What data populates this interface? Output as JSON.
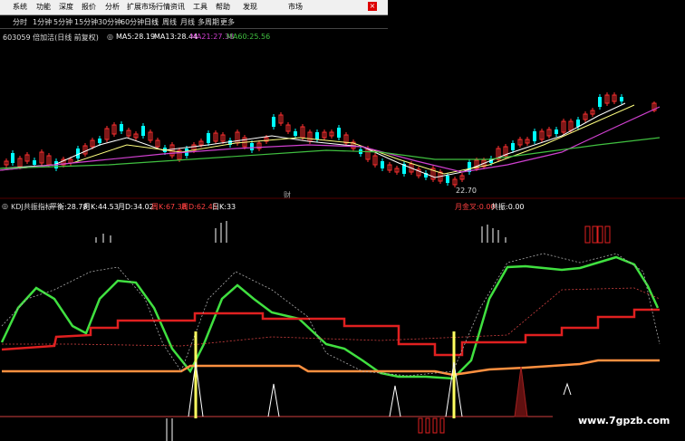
{
  "menu": {
    "items": [
      "系统",
      "功能",
      "深度",
      "报价",
      "分析",
      "扩展市场行情",
      "资讯",
      "工具",
      "帮助"
    ],
    "right_items": [
      "发现",
      "市场"
    ]
  },
  "period_tabs": [
    "分时",
    "1分钟",
    "5分钟",
    "15分钟",
    "30分钟",
    "60分钟",
    "日线",
    "周线",
    "月线",
    "多周期",
    "更多"
  ],
  "stock": {
    "title": "603059 倍加洁(日线 前复权)",
    "ma": [
      {
        "label": "MA5:",
        "value": "28.19",
        "color": "#ffffff"
      },
      {
        "label": "MA13:",
        "value": "28.44",
        "color": "#ffffff"
      },
      {
        "label": "MA21:",
        "value": "27.38",
        "color": "#d040d0"
      },
      {
        "label": "MA60:",
        "value": "25.56",
        "color": "#40c040"
      }
    ],
    "low_label": "22.70",
    "cai_label": "财"
  },
  "indicator": {
    "name": "KDJ共振指标",
    "fields": [
      {
        "label": "平衡:",
        "value": "28.78",
        "color": "#ffffff"
      },
      {
        "label": "月K:",
        "value": "44.53",
        "color": "#ffffff"
      },
      {
        "label": "月D:",
        "value": "34.02",
        "color": "#ffffff"
      },
      {
        "label": "周K:",
        "value": "67.38",
        "color": "#ff4040"
      },
      {
        "label": "周D:",
        "value": "62.45",
        "color": "#ff4040"
      },
      {
        "label": "日K:",
        "value": "33",
        "color": "#ffffff"
      }
    ],
    "extra": [
      {
        "label": "月金叉:",
        "value": "0.00",
        "color": "#ff4040"
      },
      {
        "label": "共振:",
        "value": "0.00",
        "color": "#ffffff"
      }
    ]
  },
  "watermark": "www.7gpzb.com",
  "colors": {
    "up": "#ff3030",
    "down": "#00ffff",
    "ma5": "#ffffff",
    "ma21": "#d040d0",
    "ma60": "#40c040",
    "green": "#40e040",
    "red": "#e02020",
    "orange": "#ff9040",
    "yellow": "#ffff60"
  }
}
